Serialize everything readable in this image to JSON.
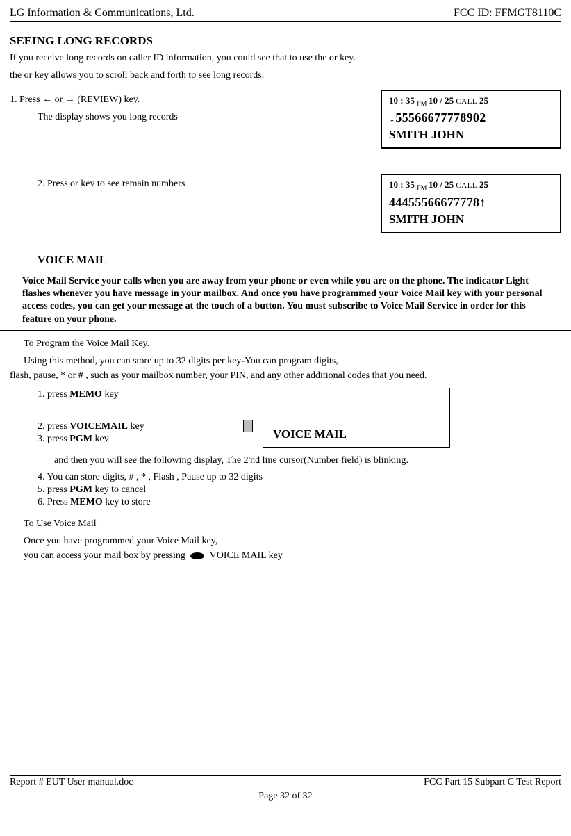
{
  "header": {
    "company": "LG Information & Communications, Ltd.",
    "fccid": "FCC ID: FFMGT8110C"
  },
  "section1_title": "SEEING LONG RECORDS",
  "intro1": "If you receive long records on caller ID information, you could see that to use the      or      key.",
  "intro2": "the      or      key allows you to scroll back and forth to see long records.",
  "step1_prefix": "1. Press  ",
  "step1_suffix": " (REVIEW) key.",
  "or_word": "  or  ",
  "left_arrow": "←",
  "right_arrow": "→",
  "down_arrow": "↓",
  "up_arrow": "↑",
  "step1_desc": "The display shows you long records",
  "lcd1": {
    "time": "10 : 35 ",
    "pm": "PM ",
    "date": "10 / 25",
    "calltxt": "  CALL  ",
    "callnum": "25",
    "number_prefix": "↓",
    "number": "55566677778902",
    "name": "SMITH JOHN"
  },
  "step2": "2. Press      or      key to see remain numbers",
  "lcd2": {
    "time": "10 : 35 ",
    "pm": "PM ",
    "date": "10 / 25",
    "calltxt": "  CALL  ",
    "callnum": "25",
    "number": "44455566677778",
    "number_suffix": "↑",
    "name": "SMITH JOHN"
  },
  "voice_mail_title": "VOICE MAIL",
  "voice_mail_para": "Voice Mail Service your calls when you are away from your phone or even while you are on the phone. The indicator Light flashes whenever you have message in your mailbox. And once you have programmed your Voice Mail key with your personal access codes, you can get your message at the touch of a button. You must subscribe to Voice Mail Service in order for this feature on your phone.",
  "program_title": "To Program the Voice Mail Key.",
  "program_intro1": "Using this method, you can store up to 32 digits per key-You can program digits,",
  "program_intro2": "flash, pause, * or # , such as your mailbox number, your PIN, and any other additional codes that you need.",
  "steps": {
    "s1a": "1. press ",
    "s1b": "MEMO",
    "s1c": " key",
    "s2a": "2. press ",
    "s2b": "VOICEMAIL",
    "s2c": " key",
    "s3a": "3. press ",
    "s3b": "PGM",
    "s3c": " key"
  },
  "lcd_small_label": "VOICE MAIL",
  "after1": "and then you will see the following display, The 2'nd line cursor(Number field) is blinking.",
  "after2": "4. You can store digits, # , * , Flash , Pause up to 32 digits",
  "after3a": "5. press ",
  "after3b": "PGM",
  "after3c": " key to cancel",
  "after4a": "6. Press ",
  "after4b": "MEMO",
  "after4c": " key to store",
  "use_title": "To Use Voice Mail",
  "use_p1": "Once you have programmed your Voice Mail key,",
  "use_p2a": "you can access your mail box by pressing ",
  "use_p2b": " VOICE MAIL key",
  "footer": {
    "left": "Report # EUT User manual.doc",
    "right": "FCC Part 15 Subpart C Test Report",
    "center": "Page 32 of 32"
  }
}
